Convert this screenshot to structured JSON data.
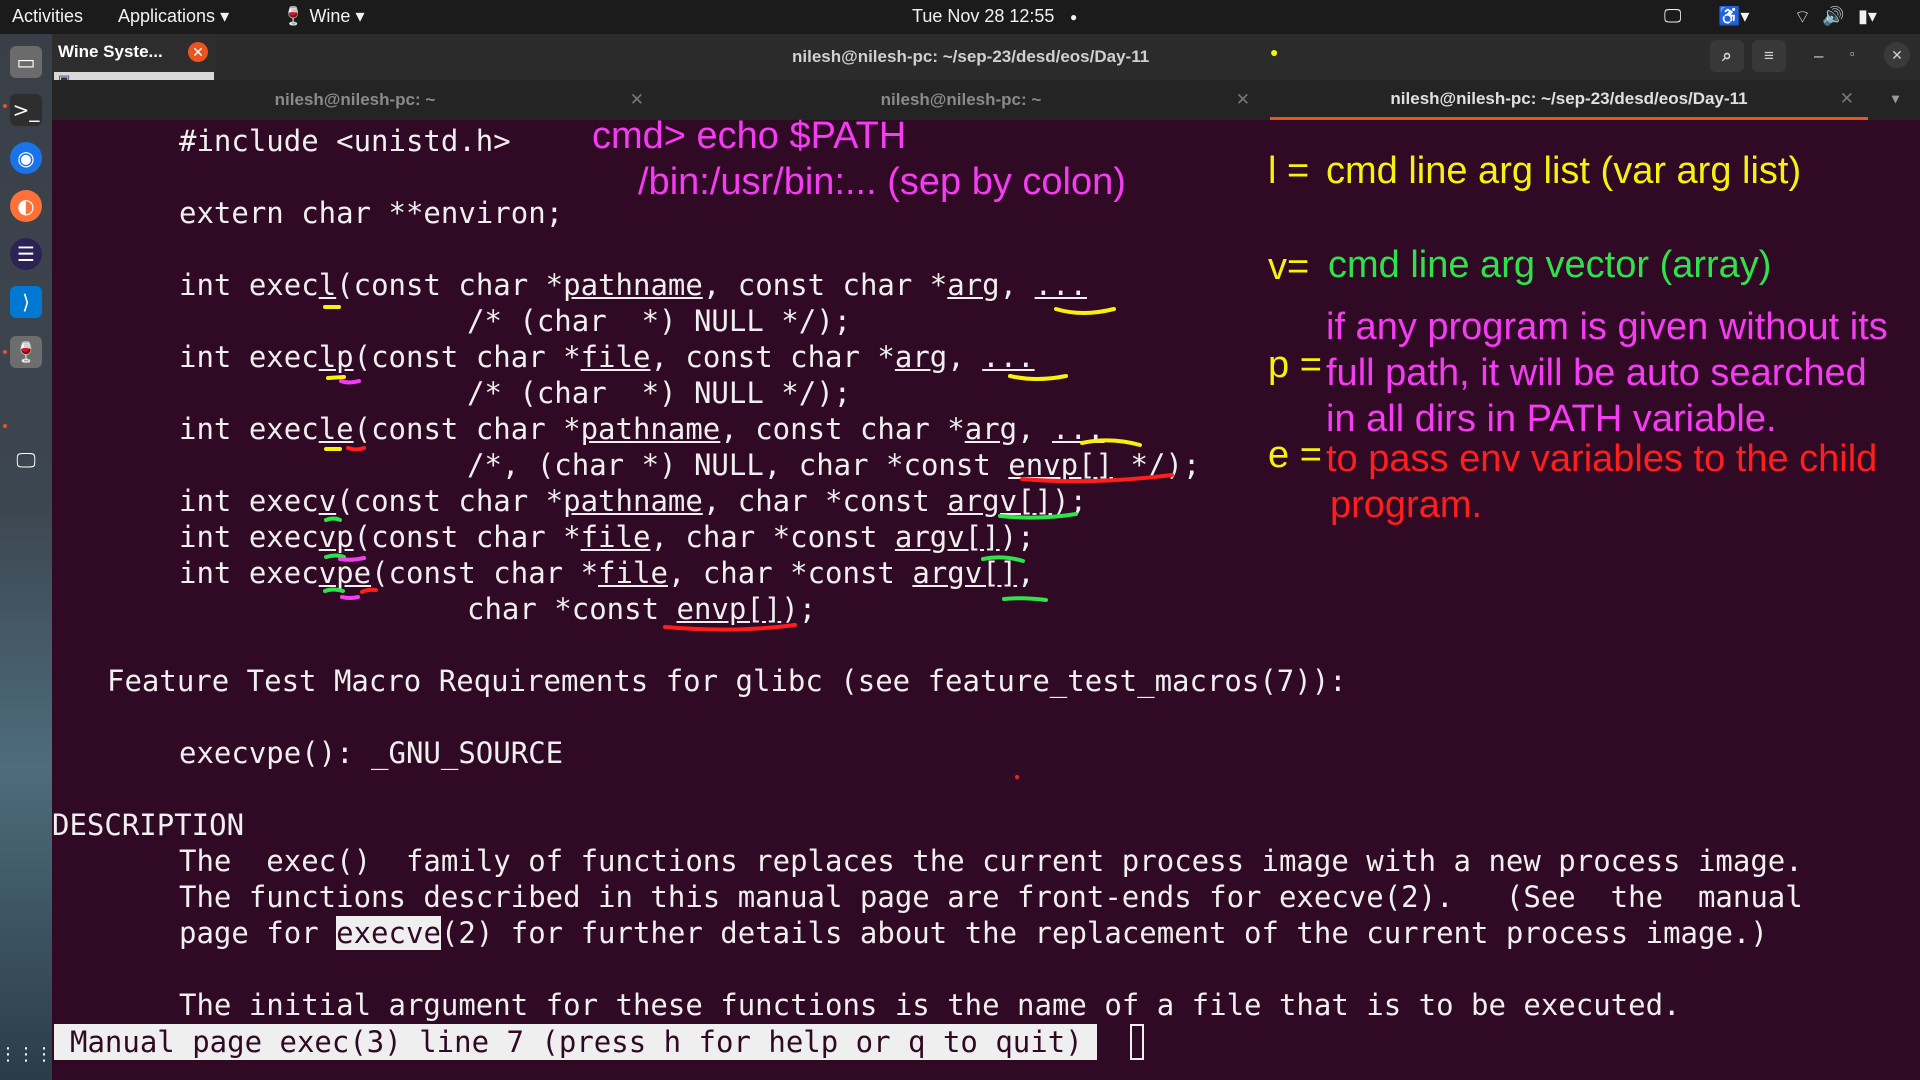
{
  "topbar": {
    "activities": "Activities",
    "applications": "Applications",
    "app_menu": "Wine",
    "clock": "Tue Nov 28  12:55"
  },
  "wine_window": {
    "title": "Wine Syste..."
  },
  "terminal": {
    "title": "nilesh@nilesh-pc: ~/sep-23/desd/eos/Day-11",
    "tabs": [
      {
        "label": "nilesh@nilesh-pc: ~"
      },
      {
        "label": "nilesh@nilesh-pc: ~"
      },
      {
        "label": "nilesh@nilesh-pc: ~/sep-23/desd/eos/Day-11"
      }
    ]
  },
  "man": {
    "include": "#include <unistd.h>",
    "environ": "extern char **environ;",
    "execl_a": "int exec",
    "execl_b": "l",
    "execl_c": "(const char *",
    "execl_d": "pathname",
    "execl_e": ", const char *",
    "execl_f": "arg",
    "execl_g": ", ",
    "execl_h": "...",
    "null1": "/* (char  *) NULL */);",
    "execlp_a": "int exec",
    "execlp_b": "lp",
    "execlp_c": "(const char *",
    "execlp_d": "file",
    "execlp_e": ", const char *",
    "execlp_f": "arg",
    "execlp_g": ", ",
    "execlp_h": "...",
    "null2": "/* (char  *) NULL */);",
    "execle_a": "int exec",
    "execle_b": "le",
    "execle_c": "(const char *",
    "execle_d": "pathname",
    "execle_e": ", const char *",
    "execle_f": "arg",
    "execle_g": ", ",
    "execle_h": "...",
    "envp_a": "/*, (char *) NULL, char *const ",
    "envp_b": "envp[]",
    "envp_c": " */);",
    "execv_a": "int exec",
    "execv_b": "v",
    "execv_c": "(const char *",
    "execv_d": "pathname",
    "execv_e": ", char *const ",
    "execv_f": "argv[]",
    "execv_g": ");",
    "execvp_a": "int exec",
    "execvp_b": "vp",
    "execvp_c": "(const char *",
    "execvp_d": "file",
    "execvp_e": ", char *const ",
    "execvp_f": "argv[]",
    "execvp_g": ");",
    "execvpe_a": "int exec",
    "execvpe_b": "vpe",
    "execvpe_c": "(const char *",
    "execvpe_d": "file",
    "execvpe_e": ", char *const ",
    "execvpe_f": "argv[]",
    "execvpe_g": ",",
    "envp2_a": "char *const ",
    "envp2_b": "envp[]",
    "envp2_c": ");",
    "ftm": "Feature Test Macro Requirements for glibc (see feature_test_macros(7)):",
    "execvpe_req": "execvpe(): _GNU_SOURCE",
    "desc_head": "DESCRIPTION",
    "desc1": "The  exec()  family of functions replaces the current process image with a new process image.",
    "desc2": "The functions described in this manual page are front-ends for execve(2).   (See  the  manual",
    "desc3_a": "page for ",
    "desc3_b": "execve",
    "desc3_c": "(2) for further details about the replacement of the current process image.)",
    "desc4": "The initial argument for these functions is the name of a file that is to be executed.",
    "status": "Manual page exec(3) line 7 (press h for help or q to quit)"
  },
  "annotations": {
    "cmd": "cmd> echo $PATH",
    "path": "/bin:/usr/bin:... (sep by colon)",
    "l_letter": "l =",
    "l_text": "cmd line arg list (var arg list)",
    "v_letter": "v=",
    "v_text": "cmd line arg vector (array)",
    "p_letter": "p =",
    "p_text1": "if any program is given without its",
    "p_text2": "full path, it will be auto searched",
    "p_text3": "in all dirs in PATH variable.",
    "e_letter": "e =",
    "e_text1": "to pass env variables to the child",
    "e_text2": "program."
  },
  "colors": {
    "terminal_bg": "#300a24",
    "yellow": "#f7f10f",
    "green": "#2fe24b",
    "magenta": "#f43cf2",
    "red": "#ff1e1e",
    "accent": "#e95420"
  }
}
